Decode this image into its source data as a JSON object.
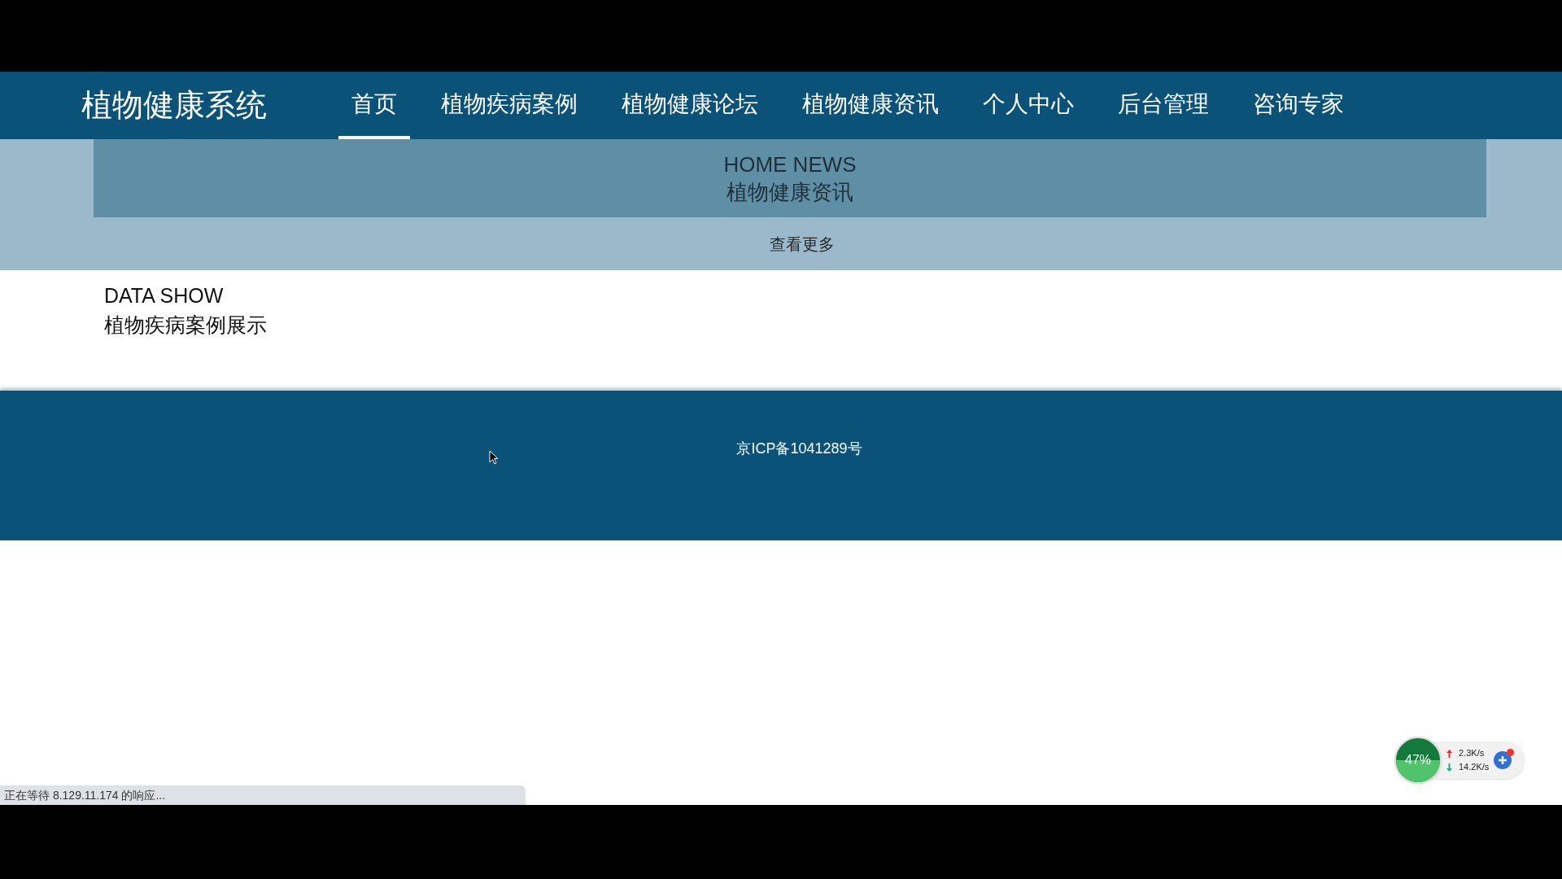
{
  "nav": {
    "logo": "植物健康系统",
    "items": [
      {
        "label": "首页",
        "selected": true
      },
      {
        "label": "植物疾病案例",
        "selected": false
      },
      {
        "label": "植物健康论坛",
        "selected": false
      },
      {
        "label": "植物健康资讯",
        "selected": false
      },
      {
        "label": "个人中心",
        "selected": false
      },
      {
        "label": "后台管理",
        "selected": false
      },
      {
        "label": "咨询专家",
        "selected": false
      }
    ]
  },
  "news": {
    "title_en": "HOME NEWS",
    "title": "植物健康资讯",
    "more": "查看更多"
  },
  "data_show": {
    "title_en": "DATA SHOW",
    "title": "植物疾病案例展示"
  },
  "footer": {
    "text": "京ICP备1041289号"
  },
  "status_bar": {
    "text": "正在等待 8.129.11.174 的响应..."
  },
  "net_widget": {
    "percent": "47%",
    "upload": "2.3K/s",
    "download": "14.2K/s"
  }
}
